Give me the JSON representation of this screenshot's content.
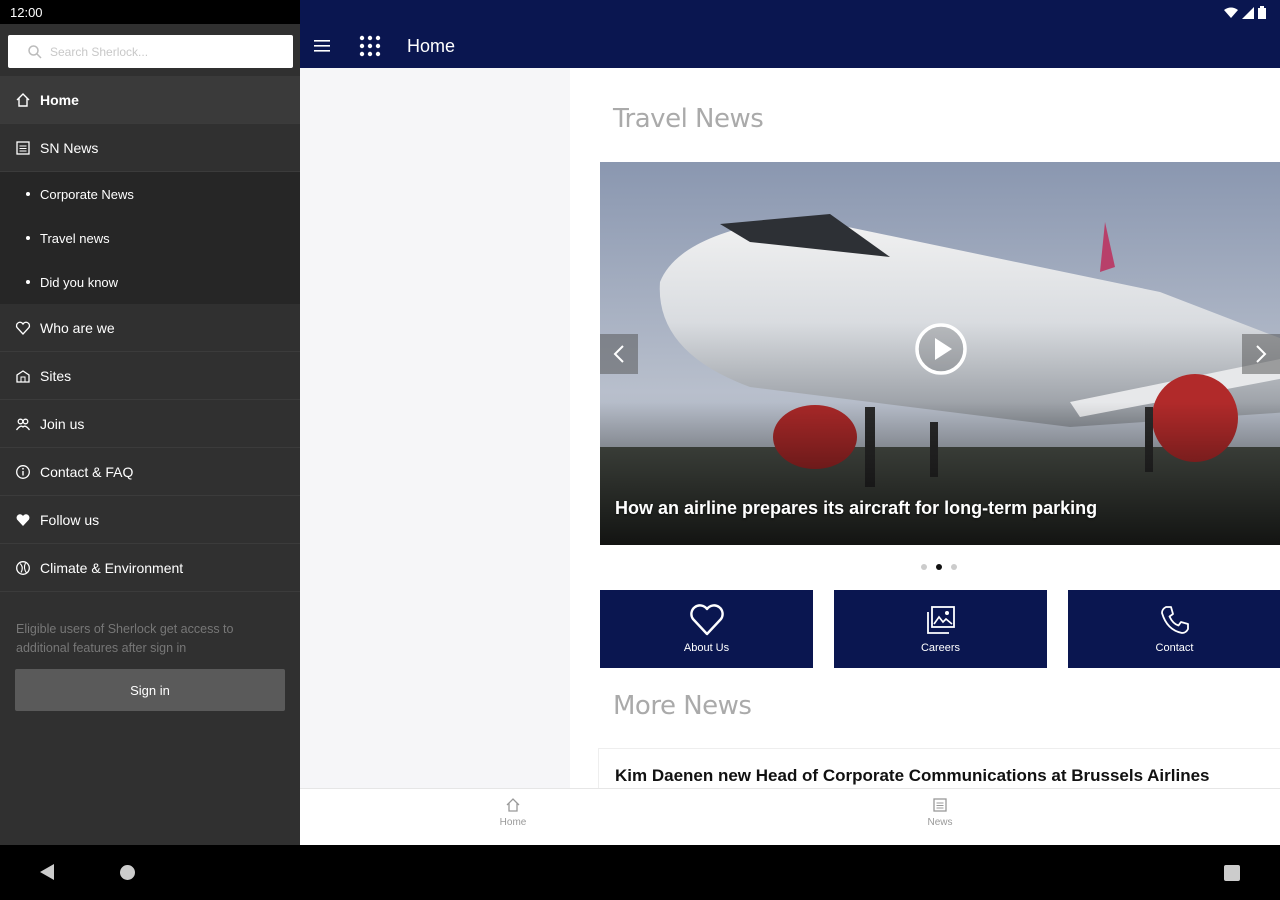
{
  "status_bar": {
    "time": "12:00"
  },
  "drawer": {
    "search_placeholder": "Search Sherlock...",
    "items": [
      {
        "label": "Home",
        "icon": "home-icon"
      },
      {
        "label": "SN News",
        "icon": "newspaper-icon"
      },
      {
        "label": "Who are we",
        "icon": "heart-outline-icon"
      },
      {
        "label": "Sites",
        "icon": "building-icon"
      },
      {
        "label": "Join us",
        "icon": "people-icon"
      },
      {
        "label": "Contact & FAQ",
        "icon": "info-circle-icon"
      },
      {
        "label": "Follow us",
        "icon": "heart-filled-icon"
      },
      {
        "label": "Climate & Environment",
        "icon": "globe-icon"
      }
    ],
    "sub_items": [
      "Corporate News",
      "Travel news",
      "Did you know"
    ],
    "note": "Eligible users of Sherlock get access to additional features after sign in",
    "sign_in_label": "Sign in"
  },
  "app_bar": {
    "title": "Home"
  },
  "main": {
    "travel_news_title": "Travel News",
    "carousel": {
      "caption": "How an airline prepares its aircraft for long-term parking",
      "active_index": 1,
      "count": 3
    },
    "tiles": [
      {
        "label": "About Us",
        "icon": "heart-outline-icon"
      },
      {
        "label": "Careers",
        "icon": "image-gallery-icon"
      },
      {
        "label": "Contact",
        "icon": "phone-icon"
      }
    ],
    "more_news_title": "More News",
    "news": [
      {
        "title": "Kim Daenen new Head of Corporate Communications at Brussels Airlines"
      }
    ]
  },
  "bottom_nav": {
    "items": [
      {
        "label": "Home",
        "icon": "home-icon"
      },
      {
        "label": "News",
        "icon": "newspaper-icon"
      }
    ]
  },
  "colors": {
    "brand_navy": "#0a1650",
    "drawer_bg": "#303030",
    "sub_bg": "#262626"
  }
}
